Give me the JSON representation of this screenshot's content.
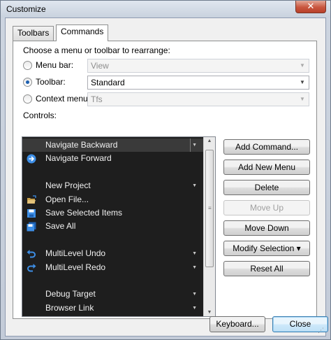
{
  "window": {
    "title": "Customize",
    "close_glyph": "✕"
  },
  "tabs": [
    {
      "label": "Toolbars"
    },
    {
      "label": "Commands"
    }
  ],
  "choose_label": "Choose a menu or toolbar to rearrange:",
  "options": {
    "menu_bar": {
      "label": "Menu bar:",
      "value": "View",
      "selected": false
    },
    "toolbar": {
      "label": "Toolbar:",
      "value": "Standard",
      "selected": true
    },
    "context_menu": {
      "label": "Context menu:",
      "value": "Tfs",
      "selected": false
    }
  },
  "controls_label": "Controls:",
  "controls": [
    {
      "label": "Navigate Backward",
      "icon": "",
      "dropdown": true,
      "selected": true
    },
    {
      "label": "Navigate Forward",
      "icon": "navigate-forward-icon",
      "dropdown": false,
      "selected": false
    },
    {
      "label": "",
      "icon": "",
      "dropdown": false,
      "selected": false
    },
    {
      "label": "New Project",
      "icon": "",
      "dropdown": true,
      "selected": false
    },
    {
      "label": "Open File...",
      "icon": "open-file-icon",
      "dropdown": false,
      "selected": false
    },
    {
      "label": "Save Selected Items",
      "icon": "save-icon",
      "dropdown": false,
      "selected": false
    },
    {
      "label": "Save All",
      "icon": "save-all-icon",
      "dropdown": false,
      "selected": false
    },
    {
      "label": "",
      "icon": "",
      "dropdown": false,
      "selected": false
    },
    {
      "label": "MultiLevel Undo",
      "icon": "undo-icon",
      "dropdown": true,
      "selected": false
    },
    {
      "label": "MultiLevel Redo",
      "icon": "redo-icon",
      "dropdown": true,
      "selected": false
    },
    {
      "label": "",
      "icon": "",
      "dropdown": false,
      "selected": false
    },
    {
      "label": "Debug Target",
      "icon": "",
      "dropdown": true,
      "selected": false
    },
    {
      "label": "Browser Link",
      "icon": "",
      "dropdown": true,
      "selected": false
    }
  ],
  "actions": {
    "add_command": "Add Command...",
    "add_new_menu": "Add New Menu",
    "delete": "Delete",
    "move_up": "Move Up",
    "move_down": "Move Down",
    "modify_selection": "Modify Selection ▾",
    "reset_all": "Reset All"
  },
  "footer": {
    "keyboard": "Keyboard...",
    "close": "Close"
  },
  "colors": {
    "list_bg": "#1e1e1e",
    "selected_row": "#3a3a3a",
    "icon_blue": "#3d8ee6"
  }
}
